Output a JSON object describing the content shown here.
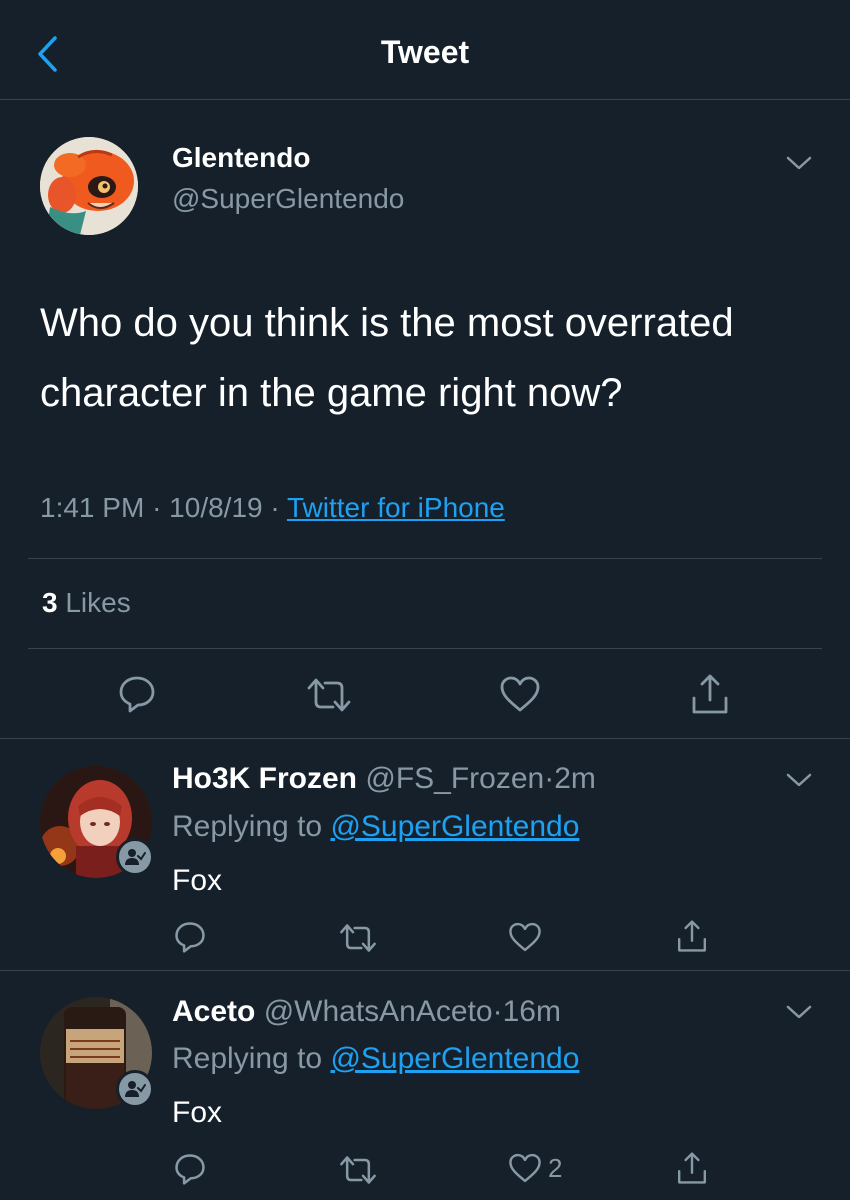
{
  "header": {
    "title": "Tweet"
  },
  "tweet": {
    "author_name": "Glentendo",
    "author_handle": "@SuperGlentendo",
    "text": "Who do you think is the most overrated character in the game right now?",
    "time": "1:41 PM",
    "date": "10/8/19",
    "source": "Twitter for iPhone",
    "separator": "·",
    "likes_count": "3",
    "likes_label": "Likes"
  },
  "replies": [
    {
      "name": "Ho3K Frozen",
      "handle": "@FS_Frozen",
      "time": "2m",
      "replying_prefix": "Replying to",
      "replying_to": "@SuperGlentendo",
      "text": "Fox",
      "like_count": ""
    },
    {
      "name": "Aceto",
      "handle": "@WhatsAnAceto",
      "time": "16m",
      "replying_prefix": "Replying to",
      "replying_to": "@SuperGlentendo",
      "text": "Fox",
      "like_count": "2"
    }
  ],
  "icons": [
    "back-chevron-icon",
    "chevron-down-icon",
    "reply-icon",
    "retweet-icon",
    "like-icon",
    "share-icon",
    "follow-badge-icon"
  ],
  "colors": {
    "background": "#15202b",
    "text": "#ffffff",
    "secondary": "#8899a6",
    "accent": "#1da1f2",
    "divider": "#38444d"
  }
}
